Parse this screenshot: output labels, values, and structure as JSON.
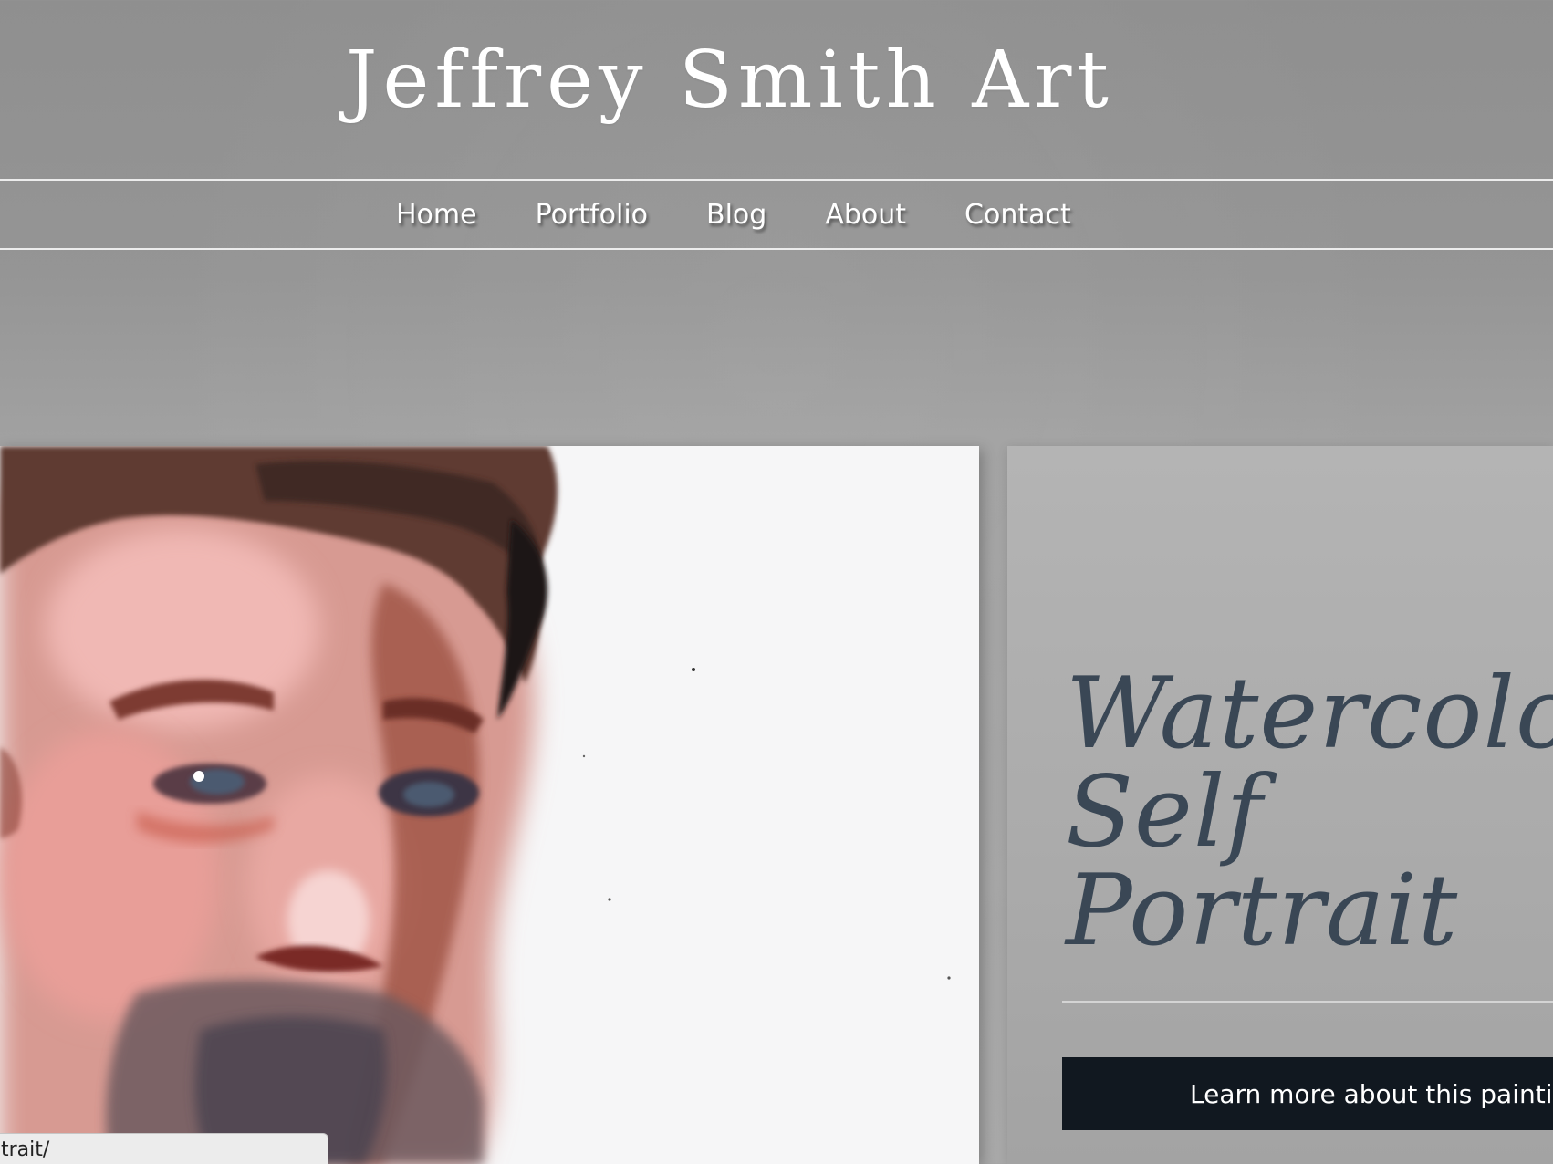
{
  "site": {
    "title": "Jeffrey Smith Art"
  },
  "nav": {
    "items": [
      {
        "label": "Home"
      },
      {
        "label": "Portfolio"
      },
      {
        "label": "Blog"
      },
      {
        "label": "About"
      },
      {
        "label": "Contact"
      }
    ]
  },
  "feature": {
    "title_lines": [
      "Watercolor",
      "Self",
      "Portrait"
    ],
    "button_label": "Learn more about this painting"
  },
  "status_bar": {
    "url_text": "trait/"
  },
  "colors": {
    "title_text": "#3a4755",
    "button_bg": "#111820",
    "header_bg": "#8f8f8f"
  }
}
